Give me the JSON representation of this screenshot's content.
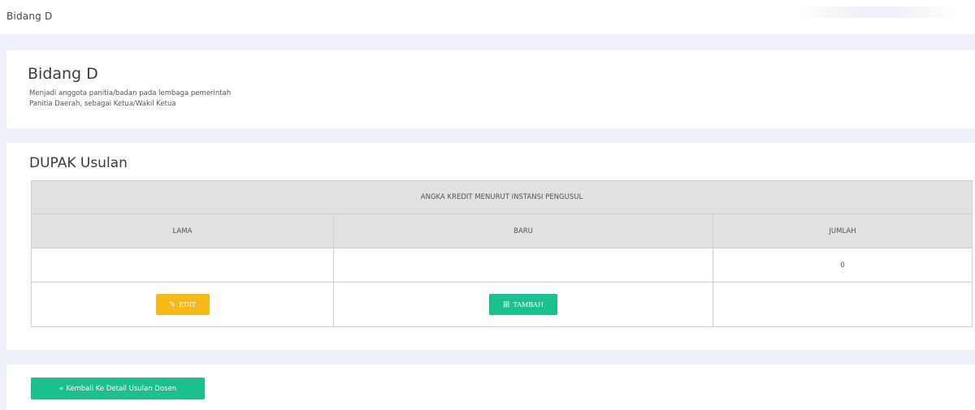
{
  "breadcrumb": "Bidang D",
  "info": {
    "title": "Bidang D",
    "line1": "Menjadi anggota panitia/badan pada lembaga pemerintah",
    "line2": "Panitia Daerah, sebagai Ketua/Wakil Ketua"
  },
  "dupak": {
    "title": "DUPAK Usulan",
    "header_main": "ANGKA KREDIT MENURUT INSTANSI PENGUSUL",
    "col_lama": "LAMA",
    "col_baru": "BARU",
    "col_jumlah": "JUMLAH",
    "value_lama": "",
    "value_baru": "",
    "value_jumlah": "0",
    "edit_label": "EDIT",
    "tambah_label": "TAMBAH"
  },
  "footer": {
    "back_label": "Kembali Ke Detail Usulan Dosen"
  },
  "colors": {
    "warning": "#f7b819",
    "success": "#1cbf8e",
    "background": "#eef1f7"
  },
  "icons": {
    "edit": "edit-icon",
    "add": "plus-square-icon",
    "back": "double-chevron-left-icon"
  }
}
